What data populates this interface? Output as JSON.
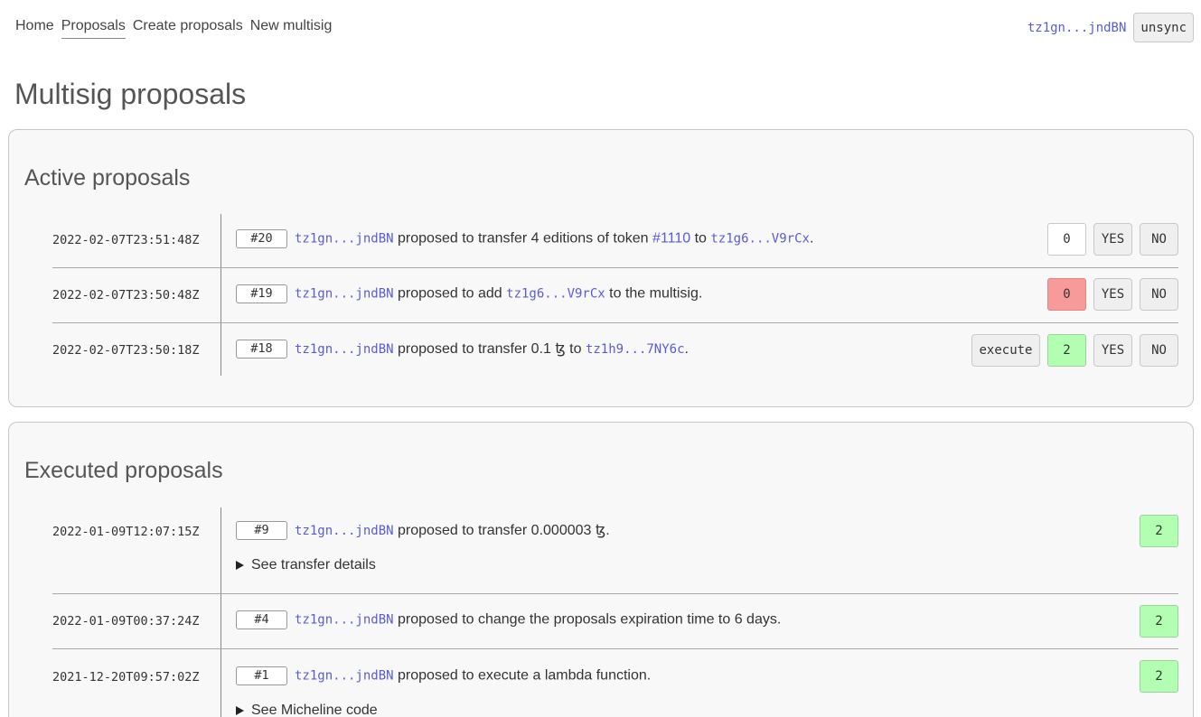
{
  "nav": {
    "home": "Home",
    "proposals": "Proposals",
    "create": "Create proposals",
    "new_multisig": "New multisig"
  },
  "account": {
    "address": "tz1gn...jndBN",
    "unsync_label": "unsync"
  },
  "page_title": "Multisig proposals",
  "active": {
    "heading": "Active proposals",
    "rows": [
      {
        "timestamp": "2022-02-07T23:51:48Z",
        "id": "#20",
        "proposer": "tz1gn...jndBN",
        "text1": "proposed to transfer 4 editions of token",
        "token": "#1110",
        "text2": "to",
        "target": "tz1g6...V9rCx",
        "text3": ".",
        "count": "0",
        "yes": "YES",
        "no": "NO"
      },
      {
        "timestamp": "2022-02-07T23:50:48Z",
        "id": "#19",
        "proposer": "tz1gn...jndBN",
        "text1": "proposed to add",
        "target": "tz1g6...V9rCx",
        "text2": "to the multisig.",
        "count": "0",
        "yes": "YES",
        "no": "NO"
      },
      {
        "timestamp": "2022-02-07T23:50:18Z",
        "id": "#18",
        "proposer": "tz1gn...jndBN",
        "text1": "proposed to transfer 0.1 ꜩ to",
        "target": "tz1h9...7NY6c",
        "text2": ".",
        "execute": "execute",
        "count": "2",
        "yes": "YES",
        "no": "NO"
      }
    ]
  },
  "executed": {
    "heading": "Executed proposals",
    "rows": [
      {
        "timestamp": "2022-01-09T12:07:15Z",
        "id": "#9",
        "proposer": "tz1gn...jndBN",
        "text1": "proposed to transfer 0.000003 ꜩ.",
        "details": "See transfer details",
        "count": "2"
      },
      {
        "timestamp": "2022-01-09T00:37:24Z",
        "id": "#4",
        "proposer": "tz1gn...jndBN",
        "text1": "proposed to change the proposals expiration time to 6 days.",
        "count": "2"
      },
      {
        "timestamp": "2021-12-20T09:57:02Z",
        "id": "#1",
        "proposer": "tz1gn...jndBN",
        "text1": "proposed to execute a lambda function.",
        "details": "See Micheline code",
        "count": "2"
      }
    ]
  },
  "colors": {
    "link": "#5b5bd6",
    "count_red": "#f99a9a",
    "count_green": "#b2ffb2"
  }
}
